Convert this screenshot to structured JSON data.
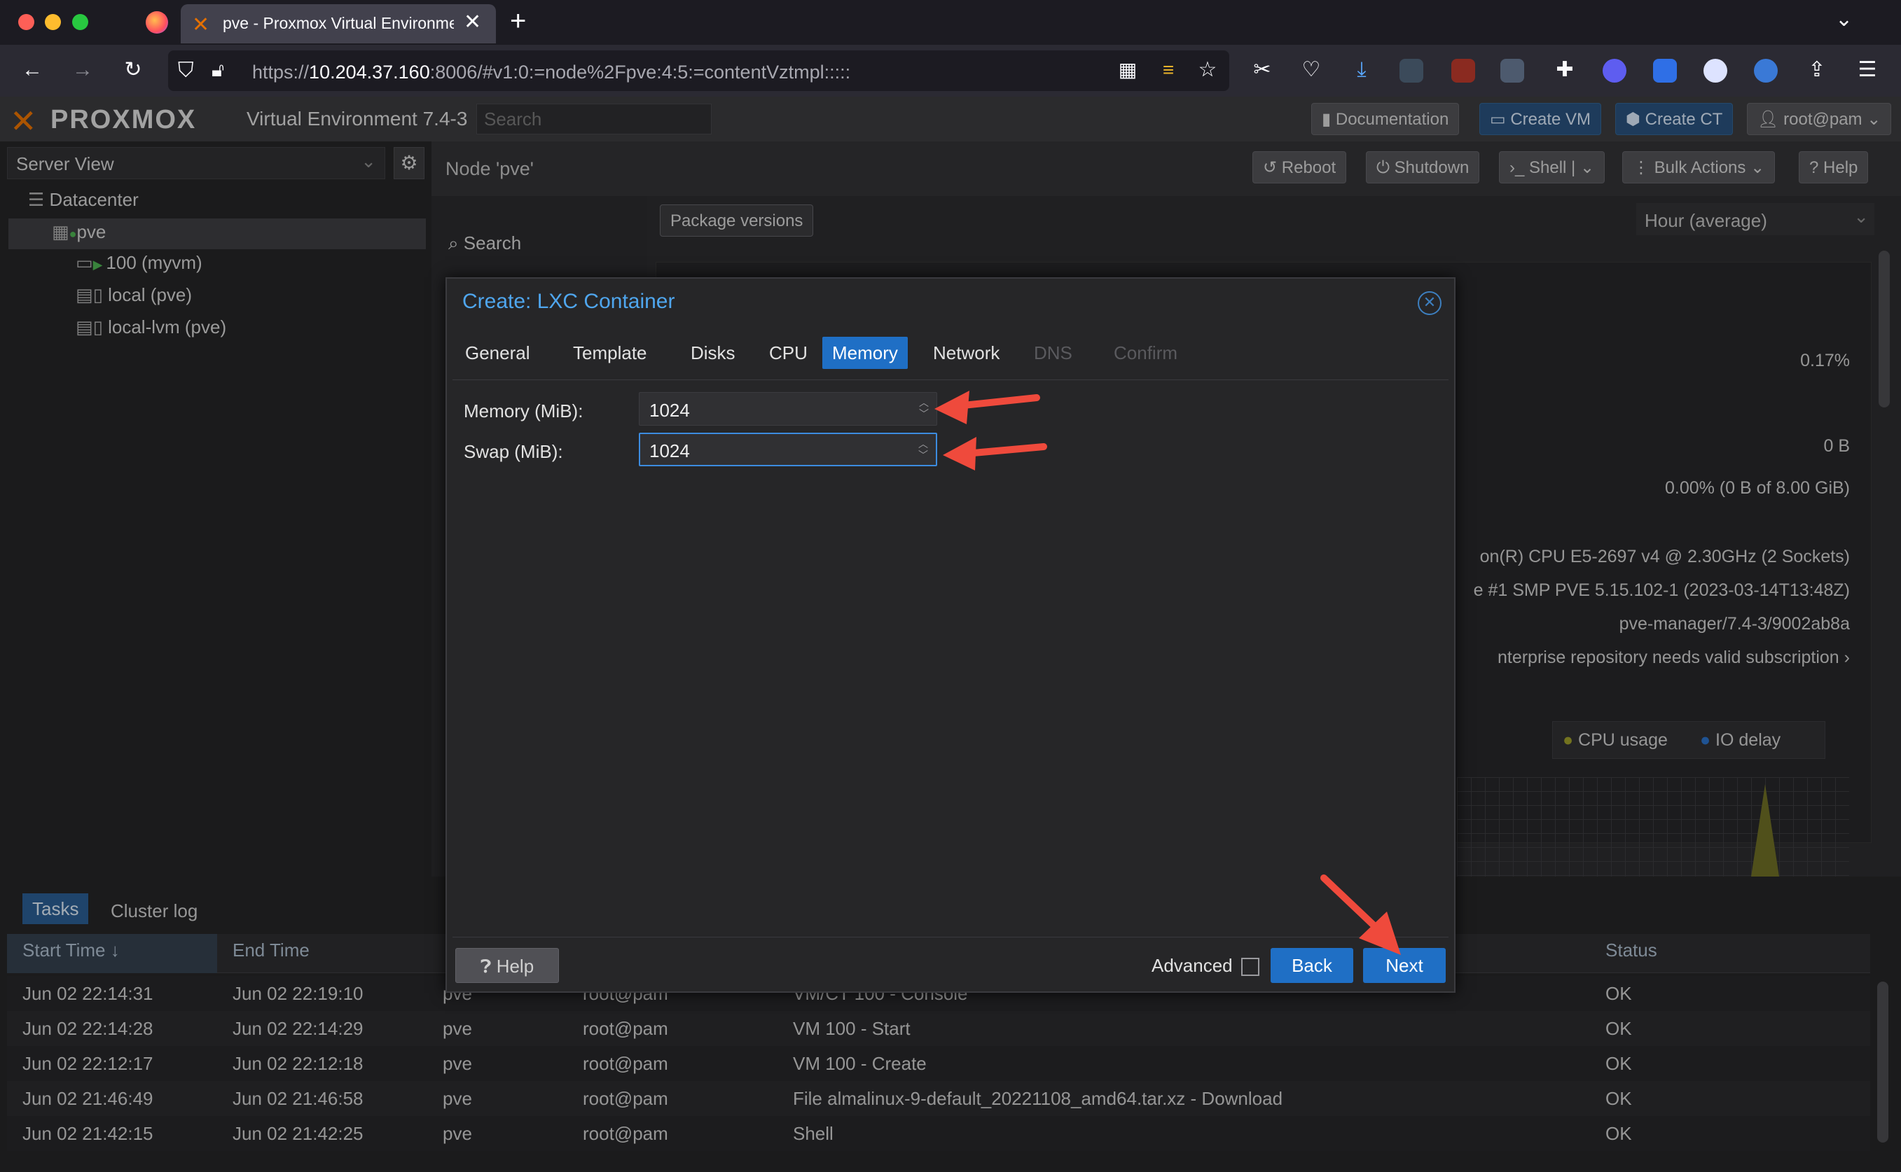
{
  "browser": {
    "tab_title": "pve - Proxmox Virtual Environme",
    "url_prefix": "https://",
    "url_host": "10.204.37.160",
    "url_rest": ":8006/#v1:0:=node%2Fpve:4:5:=contentVztmpl:::::"
  },
  "header": {
    "logo": "PROXMOX",
    "product": "Virtual Environment 7.4-3",
    "search_placeholder": "Search",
    "documentation": "Documentation",
    "create_vm": "Create VM",
    "create_ct": "Create CT",
    "user": "root@pam"
  },
  "sidebar": {
    "view": "Server View",
    "items": [
      {
        "label": "Datacenter"
      },
      {
        "label": "pve"
      },
      {
        "label": "100 (myvm)"
      },
      {
        "label": "local (pve)"
      },
      {
        "label": "local-lvm (pve)"
      }
    ]
  },
  "node": {
    "title": "Node 'pve'",
    "reboot": "Reboot",
    "shutdown": "Shutdown",
    "shell": "Shell",
    "bulk_actions": "Bulk Actions",
    "help": "Help",
    "nav_search": "Search",
    "package_versions": "Package versions",
    "timeframe": "Hour (average)"
  },
  "summary": {
    "cpu_percent": "0.17%",
    "swap_used": "0 B",
    "rootfs": "0.00% (0 B of 8.00 GiB)",
    "cpu_model": "on(R) CPU E5-2697 v4 @ 2.30GHz (2 Sockets)",
    "kernel": "e #1 SMP PVE 5.15.102-1 (2023-03-14T13:48Z)",
    "manager": "pve-manager/7.4-3/9002ab8a",
    "repo": "nterprise repository needs valid subscription",
    "legend_cpu": "CPU usage",
    "legend_io": "IO delay"
  },
  "dialog": {
    "title": "Create: LXC Container",
    "tabs": [
      {
        "label": "General"
      },
      {
        "label": "Template"
      },
      {
        "label": "Disks"
      },
      {
        "label": "CPU"
      },
      {
        "label": "Memory"
      },
      {
        "label": "Network"
      },
      {
        "label": "DNS"
      },
      {
        "label": "Confirm"
      }
    ],
    "memory_label": "Memory (MiB):",
    "memory_value": "1024",
    "swap_label": "Swap (MiB):",
    "swap_value": "1024",
    "help": "Help",
    "advanced": "Advanced",
    "back": "Back",
    "next": "Next"
  },
  "tasks": {
    "tab_tasks": "Tasks",
    "tab_cluster_log": "Cluster log",
    "columns": [
      "Start Time",
      "End Time",
      "Status"
    ],
    "rows": [
      {
        "start": "Jun 02 22:14:31",
        "end": "Jun 02 22:19:10",
        "node": "pve",
        "user": "root@pam",
        "desc": "VM/CT 100 - Console",
        "status": "OK"
      },
      {
        "start": "Jun 02 22:14:28",
        "end": "Jun 02 22:14:29",
        "node": "pve",
        "user": "root@pam",
        "desc": "VM 100 - Start",
        "status": "OK"
      },
      {
        "start": "Jun 02 22:12:17",
        "end": "Jun 02 22:12:18",
        "node": "pve",
        "user": "root@pam",
        "desc": "VM 100 - Create",
        "status": "OK"
      },
      {
        "start": "Jun 02 21:46:49",
        "end": "Jun 02 21:46:58",
        "node": "pve",
        "user": "root@pam",
        "desc": "File almalinux-9-default_20221108_amd64.tar.xz - Download",
        "status": "OK"
      },
      {
        "start": "Jun 02 21:42:15",
        "end": "Jun 02 21:42:25",
        "node": "pve",
        "user": "root@pam",
        "desc": "Shell",
        "status": "OK"
      }
    ]
  },
  "colors": {
    "accent": "#1f6fc5",
    "title_blue": "#4fa6ee",
    "annotation_arrow": "#ef4a3c"
  }
}
